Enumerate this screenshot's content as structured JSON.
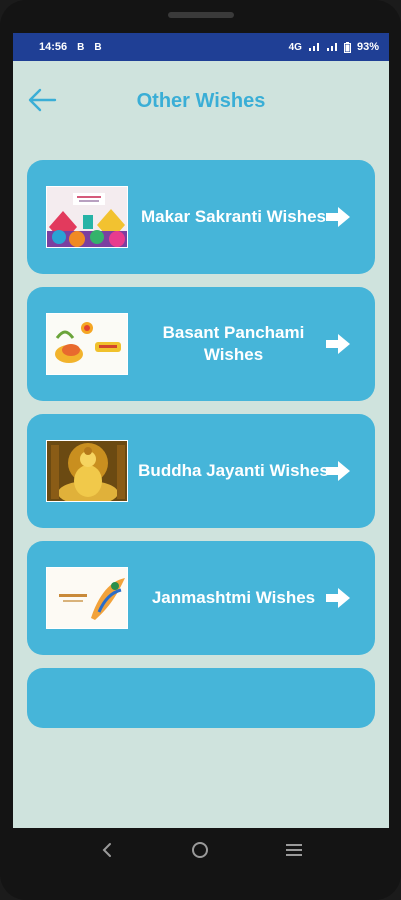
{
  "status_bar": {
    "time": "14:56",
    "left_icons": [
      "B",
      "B"
    ],
    "network": "4G",
    "battery": "93%"
  },
  "header": {
    "title": "Other Wishes",
    "back_icon": "arrow-left-icon"
  },
  "colors": {
    "screen_bg": "#cfe3dd",
    "card_bg": "#46b5d9",
    "title": "#3aaed6",
    "status_bar": "#1f3f95"
  },
  "cards": [
    {
      "label": "Makar Sakranti Wishes"
    },
    {
      "label": "Basant Panchami Wishes"
    },
    {
      "label": "Buddha Jayanti Wishes"
    },
    {
      "label": "Janmashtmi Wishes"
    }
  ],
  "nav_bar": {
    "icons": [
      "back-icon",
      "home-icon",
      "recents-icon"
    ]
  }
}
